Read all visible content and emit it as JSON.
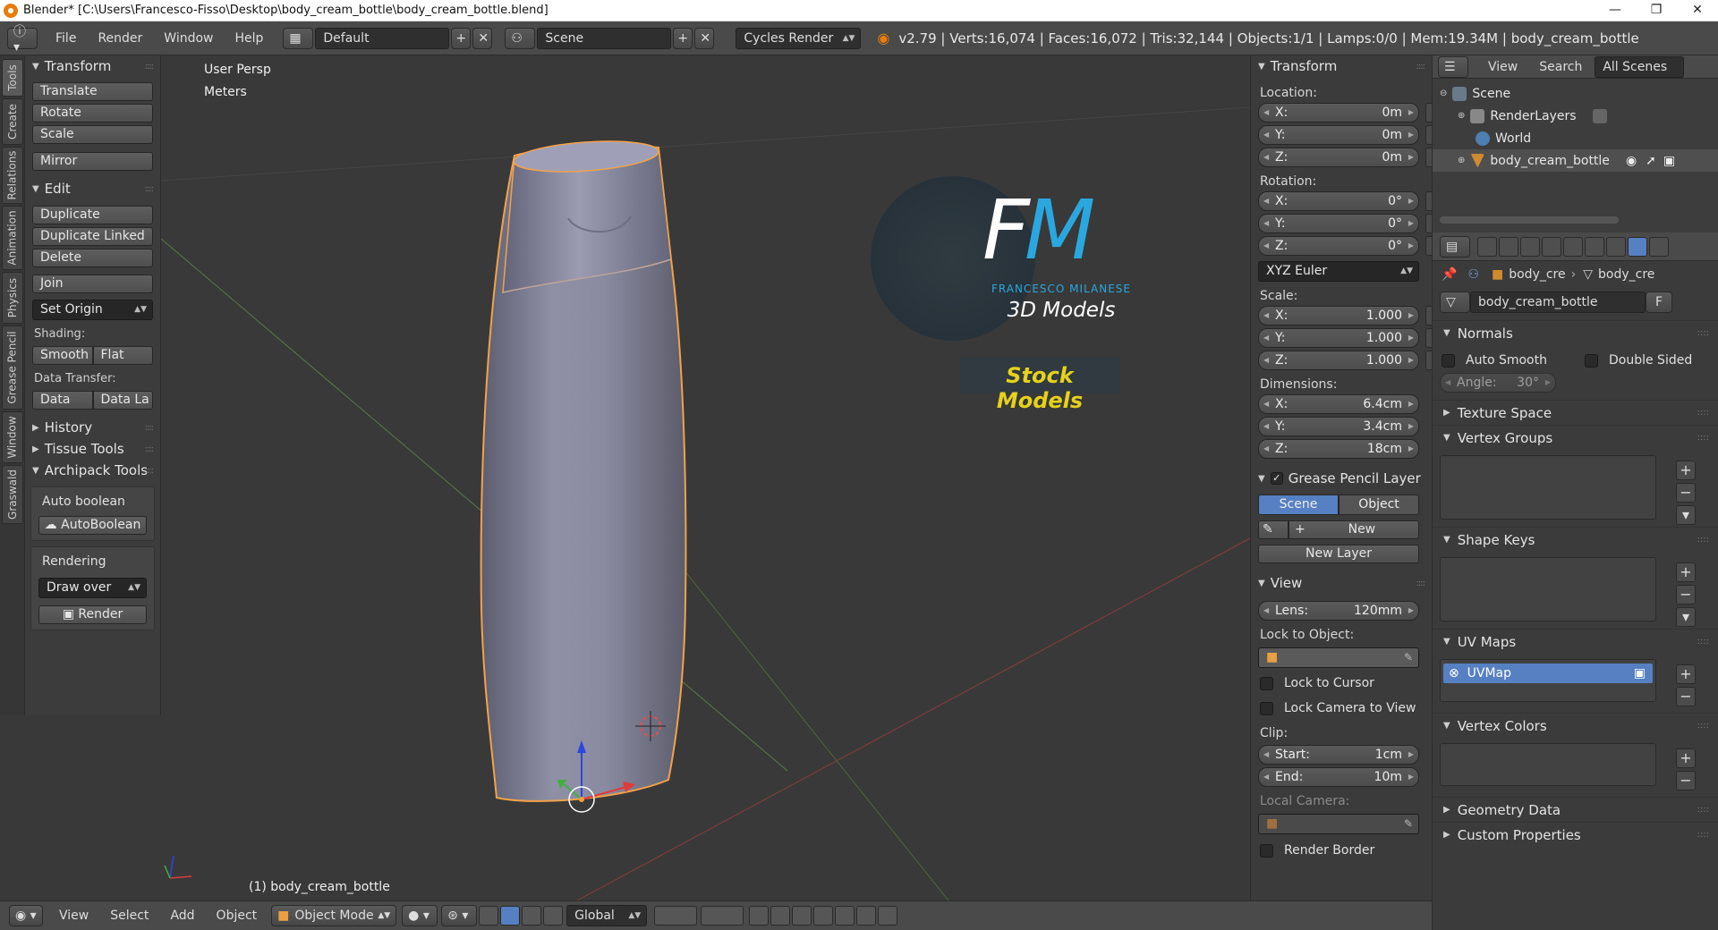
{
  "window": {
    "title": "Blender* [C:\\Users\\Francesco-Fisso\\Desktop\\body_cream_bottle\\body_cream_bottle.blend]",
    "controls": [
      "—",
      "❐",
      "✕"
    ]
  },
  "infobar": {
    "menus": [
      "File",
      "Render",
      "Window",
      "Help"
    ],
    "layout": "Default",
    "scene": "Scene",
    "engine": "Cycles Render",
    "stats": "v2.79 | Verts:16,074 | Faces:16,072 | Tris:32,144 | Objects:1/1 | Lamps:0/0 | Mem:19.34M | body_cream_bottle"
  },
  "vertical_tabs": [
    "Tools",
    "Create",
    "Relations",
    "Animation",
    "Physics",
    "Grease Pencil",
    "Window",
    "Graswald"
  ],
  "toolshelf": {
    "transform": {
      "title": "Transform",
      "buttons": [
        "Translate",
        "Rotate",
        "Scale",
        "Mirror"
      ]
    },
    "edit": {
      "title": "Edit",
      "buttons": [
        "Duplicate",
        "Duplicate Linked",
        "Delete",
        "Join"
      ],
      "set_origin": "Set Origin",
      "shading_label": "Shading:",
      "smooth": "Smooth",
      "flat": "Flat",
      "data_transfer_label": "Data Transfer:",
      "data": "Data",
      "data_la": "Data La"
    },
    "history": "History",
    "tissue": "Tissue Tools",
    "archipack": "Archipack Tools",
    "auto_boolean_label": "Auto boolean",
    "auto_boolean_btn": "AutoBoolean",
    "rendering_label": "Rendering",
    "draw_over": "Draw over",
    "render_btn": "Render"
  },
  "viewport": {
    "view_name": "User Persp",
    "units": "Meters",
    "object_label": "(1) body_cream_bottle",
    "logo": {
      "letters": "FM",
      "name": "FRANCESCO MILANESE",
      "sub": "3D Models",
      "banner": "Stock Models"
    }
  },
  "npanel": {
    "transform_title": "Transform",
    "location_label": "Location:",
    "location": [
      {
        "k": "X:",
        "v": "0m"
      },
      {
        "k": "Y:",
        "v": "0m"
      },
      {
        "k": "Z:",
        "v": "0m"
      }
    ],
    "rotation_label": "Rotation:",
    "rotation": [
      {
        "k": "X:",
        "v": "0°"
      },
      {
        "k": "Y:",
        "v": "0°"
      },
      {
        "k": "Z:",
        "v": "0°"
      }
    ],
    "rotation_mode": "XYZ Euler",
    "scale_label": "Scale:",
    "scale": [
      {
        "k": "X:",
        "v": "1.000"
      },
      {
        "k": "Y:",
        "v": "1.000"
      },
      {
        "k": "Z:",
        "v": "1.000"
      }
    ],
    "dimensions_label": "Dimensions:",
    "dimensions": [
      {
        "k": "X:",
        "v": "6.4cm"
      },
      {
        "k": "Y:",
        "v": "3.4cm"
      },
      {
        "k": "Z:",
        "v": "18cm"
      }
    ],
    "grease_title": "Grease Pencil Layer",
    "scene_btn": "Scene",
    "object_btn": "Object",
    "new_btn": "New",
    "new_layer_btn": "New Layer",
    "view_title": "View",
    "lens_k": "Lens:",
    "lens_v": "120mm",
    "lock_obj_label": "Lock to Object:",
    "lock_cursor": "Lock to Cursor",
    "lock_camera": "Lock Camera to View",
    "clip_label": "Clip:",
    "clip_start_k": "Start:",
    "clip_start_v": "1cm",
    "clip_end_k": "End:",
    "clip_end_v": "10m",
    "local_camera_label": "Local Camera:",
    "render_border": "Render Border"
  },
  "outliner": {
    "view": "View",
    "search": "Search",
    "filter": "All Scenes",
    "rows": [
      "Scene",
      "RenderLayers",
      "World",
      "body_cream_bottle"
    ]
  },
  "properties": {
    "crumb_obj": "body_cre",
    "crumb_mesh": "body_cre",
    "mesh_name": "body_cream_bottle",
    "fake_user": "F",
    "normals": "Normals",
    "auto_smooth": "Auto Smooth",
    "double_sided": "Double Sided",
    "angle_k": "Angle:",
    "angle_v": "30°",
    "texture_space": "Texture Space",
    "vertex_groups": "Vertex Groups",
    "shape_keys": "Shape Keys",
    "uv_maps": "UV Maps",
    "uvmap_item": "UVMap",
    "vertex_colors": "Vertex Colors",
    "geometry_data": "Geometry Data",
    "custom_properties": "Custom Properties"
  },
  "bottombar": {
    "menus": [
      "View",
      "Select",
      "Add",
      "Object"
    ],
    "mode": "Object Mode",
    "orientation": "Global"
  },
  "colors": {
    "accent": "#5680c2",
    "header": "#4a4a4a",
    "viewport": "#393939",
    "logo_blue": "#2aa7df",
    "logo_yellow": "#e5d21a",
    "selection": "#f5a142"
  }
}
